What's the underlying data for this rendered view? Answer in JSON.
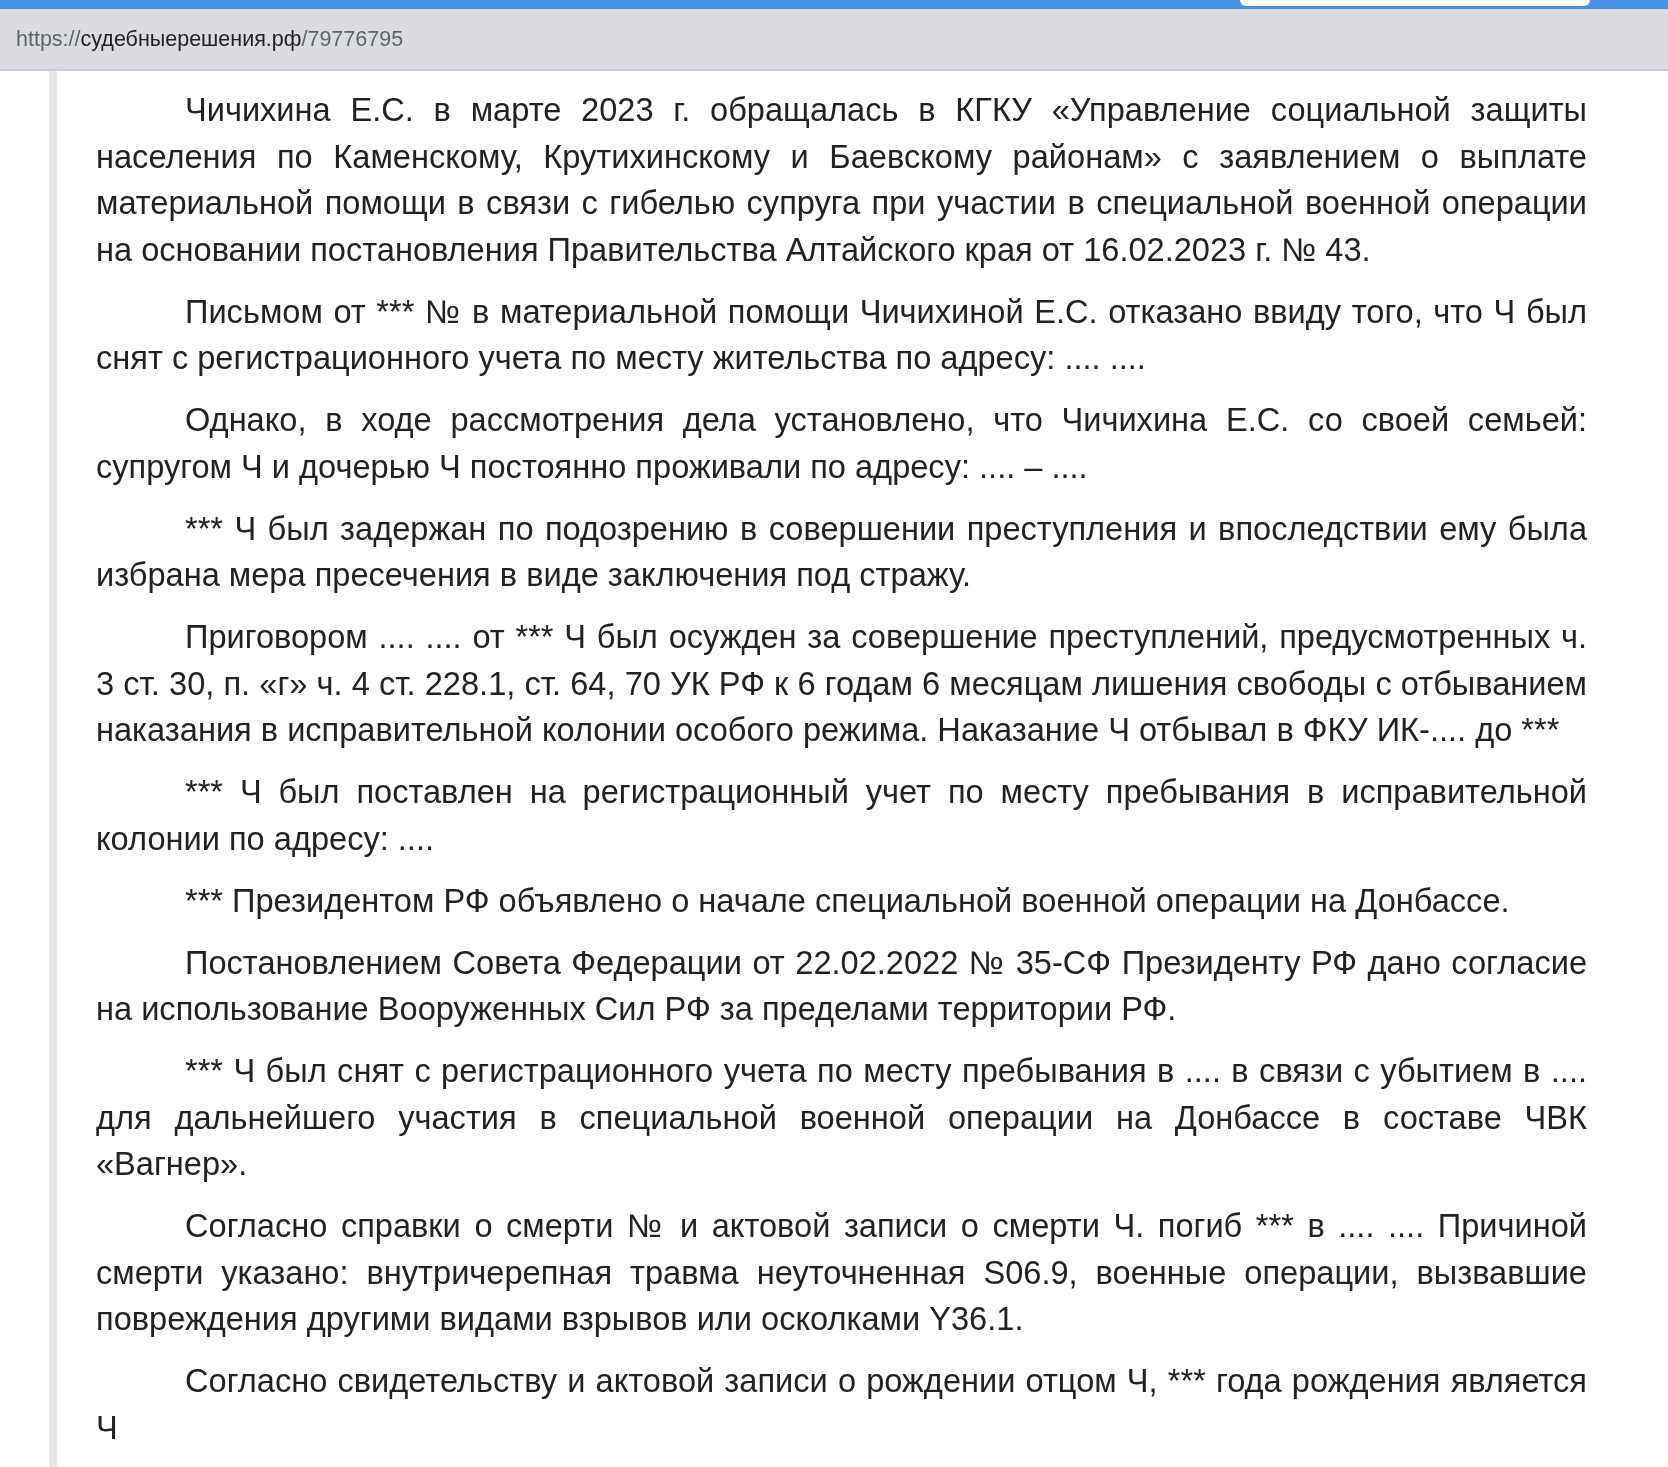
{
  "browser": {
    "url": {
      "scheme": "https://",
      "host": "судебныерешения.рф",
      "path": "/79776795"
    }
  },
  "document": {
    "paragraphs": [
      "Чичихина Е.С. в марте 2023 г. обращалась в КГКУ «Управление социальной защиты населения по Каменскому, Крутихинскому и Баевскому районам» с заявлением о выплате материальной помощи в связи с гибелью супруга при участии в специальной военной операции на основании постановления Правительства Алтайского края от 16.02.2023 г. № 43.",
      "Письмом от *** № в материальной помощи Чичихиной Е.С. отказано ввиду того, что Ч был снят с регистрационного учета по месту жительства по адресу: .... ....",
      "Однако, в ходе рассмотрения дела установлено, что Чичихина Е.С. со своей семьей: супругом Ч и дочерью Ч постоянно проживали по адресу: .... – ....",
      "*** Ч был задержан по подозрению в совершении преступления и впоследствии ему была избрана мера пресечения в виде заключения под стражу.",
      "Приговором .... .... от *** Ч был осужден за совершение преступлений, предусмотренных ч. 3 ст. 30, п. «г» ч. 4 ст. 228.1, ст. 64, 70 УК РФ к 6 годам 6 месяцам лишения свободы с отбыванием наказания в исправительной колонии особого режима. Наказание Ч отбывал в ФКУ ИК-.... до ***",
      "*** Ч был поставлен на регистрационный учет по месту пребывания в исправительной колонии по адресу: ....",
      "*** Президентом РФ объявлено о начале специальной военной операции на Донбассе.",
      "Постановлением Совета Федерации от 22.02.2022 № 35-СФ Президенту РФ дано согласие на использование Вооруженных Сил РФ за пределами территории РФ.",
      "*** Ч был снят с регистрационного учета по месту пребывания в .... в связи с убытием в .... для дальнейшего участия в специальной военной операции на Донбассе в составе ЧВК «Вагнер».",
      "Согласно справки о смерти № и актовой записи о смерти Ч. погиб *** в .... .... Причиной смерти указано: внутричерепная травма неуточненная S06.9, военные операции, вызвавшие повреждения другими видами взрывов или осколками Y36.1.",
      "Согласно свидетельству и актовой записи о рождении отцом Ч, *** года рождения является Ч"
    ]
  }
}
